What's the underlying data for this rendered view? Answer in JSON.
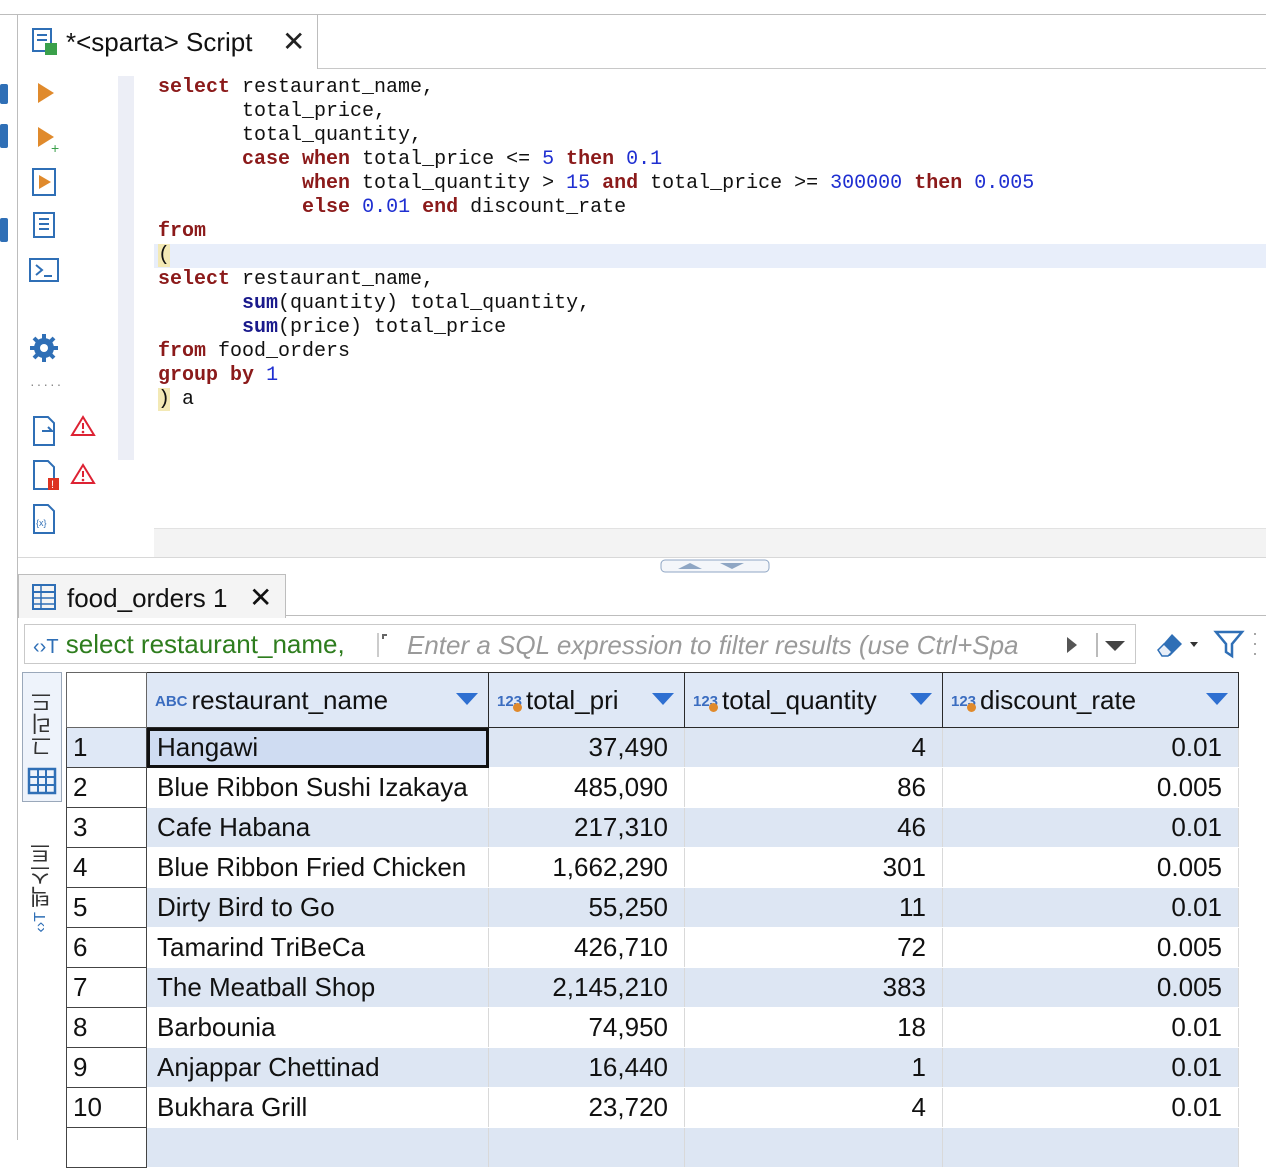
{
  "editor_tab": {
    "title": "*<sparta> Script",
    "close": "✕"
  },
  "code_lines": [
    [
      [
        "kw",
        "select"
      ],
      [
        "t",
        " restaurant_name,"
      ]
    ],
    [
      [
        "t",
        "       total_price,"
      ]
    ],
    [
      [
        "t",
        "       total_quantity,"
      ]
    ],
    [
      [
        "t",
        "       "
      ],
      [
        "kw",
        "case"
      ],
      [
        "t",
        " "
      ],
      [
        "kw",
        "when"
      ],
      [
        "t",
        " total_price <= "
      ],
      [
        "num",
        "5"
      ],
      [
        "t",
        " "
      ],
      [
        "kw",
        "then"
      ],
      [
        "t",
        " "
      ],
      [
        "num",
        "0.1"
      ]
    ],
    [
      [
        "t",
        "            "
      ],
      [
        "kw",
        "when"
      ],
      [
        "t",
        " total_quantity > "
      ],
      [
        "num",
        "15"
      ],
      [
        "t",
        " "
      ],
      [
        "kw",
        "and"
      ],
      [
        "t",
        " total_price >= "
      ],
      [
        "num",
        "300000"
      ],
      [
        "t",
        " "
      ],
      [
        "kw",
        "then"
      ],
      [
        "t",
        " "
      ],
      [
        "num",
        "0.005"
      ]
    ],
    [
      [
        "t",
        "            "
      ],
      [
        "kw",
        "else"
      ],
      [
        "t",
        " "
      ],
      [
        "num",
        "0.01"
      ],
      [
        "t",
        " "
      ],
      [
        "kw",
        "end"
      ],
      [
        "t",
        " discount_rate"
      ]
    ],
    [
      [
        "kw",
        "from"
      ]
    ],
    [
      [
        "paren",
        "("
      ]
    ],
    [
      [
        "kw",
        "select"
      ],
      [
        "t",
        " restaurant_name,"
      ]
    ],
    [
      [
        "t",
        "       "
      ],
      [
        "fn",
        "sum"
      ],
      [
        "t",
        "(quantity) total_quantity,"
      ]
    ],
    [
      [
        "t",
        "       "
      ],
      [
        "fn",
        "sum"
      ],
      [
        "t",
        "(price) total_price"
      ]
    ],
    [
      [
        "kw",
        "from"
      ],
      [
        "t",
        " food_orders"
      ]
    ],
    [
      [
        "kw",
        "group"
      ],
      [
        "t",
        " "
      ],
      [
        "kw",
        "by"
      ],
      [
        "t",
        " "
      ],
      [
        "num",
        "1"
      ]
    ],
    [
      [
        "paren",
        ")"
      ],
      [
        "t",
        " a"
      ]
    ]
  ],
  "results_tab": {
    "title": "food_orders 1",
    "close": "✕"
  },
  "filter": {
    "query": "select restaurant_name,",
    "placeholder": "Enter a SQL expression to filter results (use Ctrl+Spa"
  },
  "side_tabs": {
    "grid": "그리드",
    "text": "텍스트"
  },
  "columns": [
    {
      "badge": "ABC",
      "label": "restaurant_name",
      "align": "left"
    },
    {
      "badge": "123",
      "label": "total_pri",
      "align": "right"
    },
    {
      "badge": "123",
      "label": "total_quantity",
      "align": "right"
    },
    {
      "badge": "123",
      "label": "discount_rate",
      "align": "right"
    }
  ],
  "rows": [
    [
      "1",
      "Hangawi",
      "37,490",
      "4",
      "0.01"
    ],
    [
      "2",
      "Blue Ribbon Sushi Izakaya",
      "485,090",
      "86",
      "0.005"
    ],
    [
      "3",
      "Cafe Habana",
      "217,310",
      "46",
      "0.01"
    ],
    [
      "4",
      "Blue Ribbon Fried Chicken",
      "1,662,290",
      "301",
      "0.005"
    ],
    [
      "5",
      "Dirty Bird to Go",
      "55,250",
      "11",
      "0.01"
    ],
    [
      "6",
      "Tamarind TriBeCa",
      "426,710",
      "72",
      "0.005"
    ],
    [
      "7",
      "The Meatball Shop",
      "2,145,210",
      "383",
      "0.005"
    ],
    [
      "8",
      "Barbounia",
      "74,950",
      "18",
      "0.01"
    ],
    [
      "9",
      "Anjappar Chettinad",
      "16,440",
      "1",
      "0.01"
    ],
    [
      "10",
      "Bukhara Grill",
      "23,720",
      "4",
      "0.01"
    ]
  ],
  "colors": {
    "keyword": "#8b1a1a",
    "number": "#1f2fd1",
    "filter_query": "#2e7d1e",
    "header_bg": "#dfe8f6",
    "row_alt": "#dde6f3"
  }
}
